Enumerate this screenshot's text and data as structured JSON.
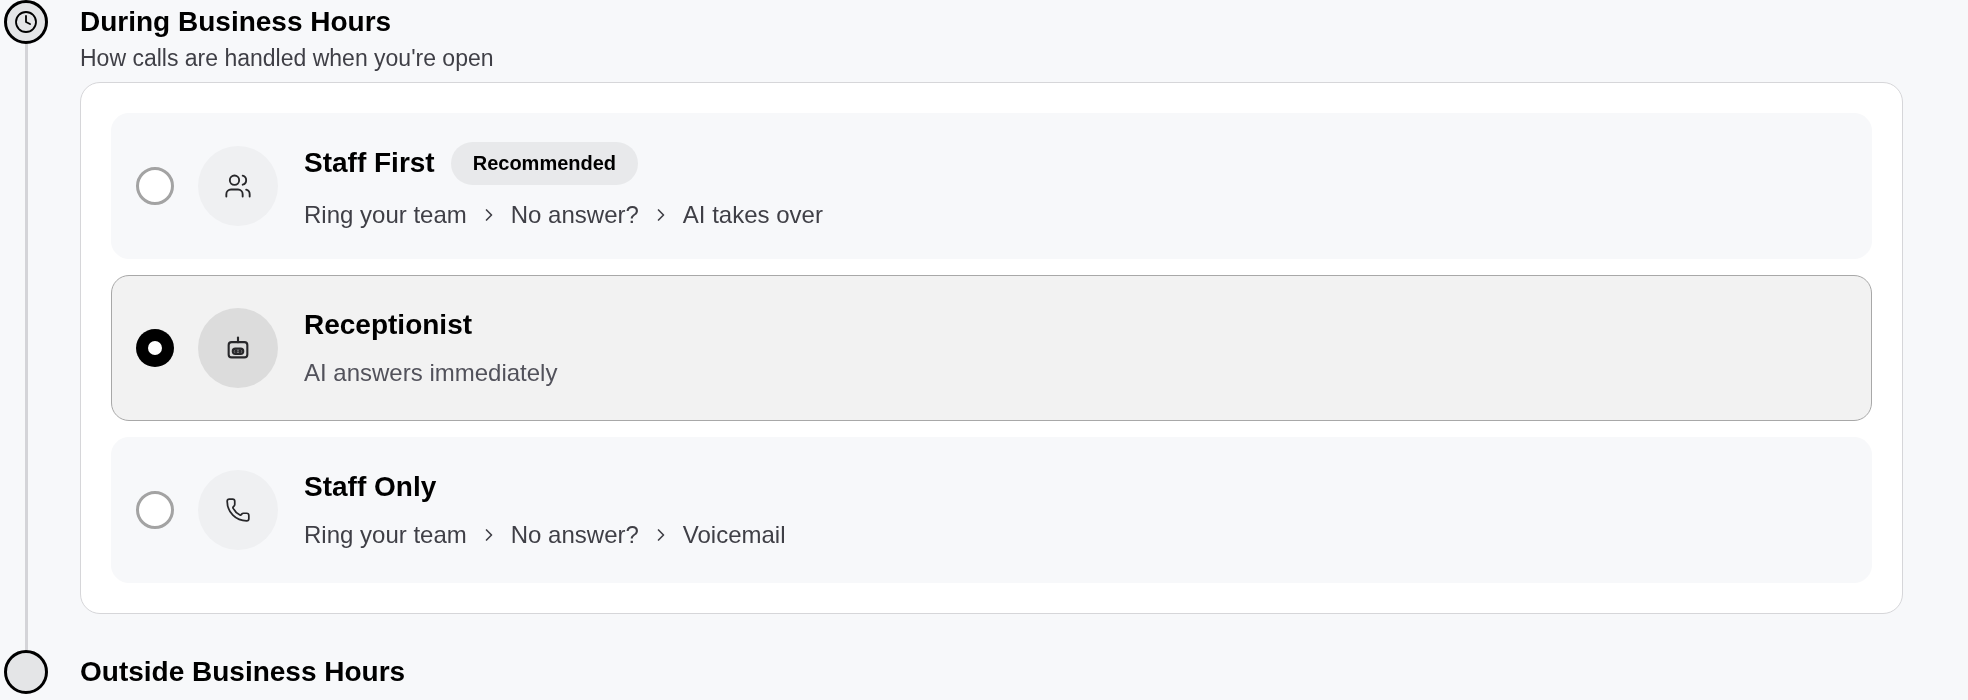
{
  "sections": [
    {
      "title": "During Business Hours",
      "subtitle": "How calls are handled when you're open",
      "options": [
        {
          "title": "Staff First",
          "badge": "Recommended",
          "steps": [
            "Ring your team",
            "No answer?",
            "AI takes over"
          ],
          "selected": false
        },
        {
          "title": "Receptionist",
          "description": "AI answers immediately",
          "selected": true
        },
        {
          "title": "Staff Only",
          "steps": [
            "Ring your team",
            "No answer?",
            "Voicemail"
          ],
          "selected": false
        }
      ]
    },
    {
      "title": "Outside Business Hours"
    }
  ]
}
